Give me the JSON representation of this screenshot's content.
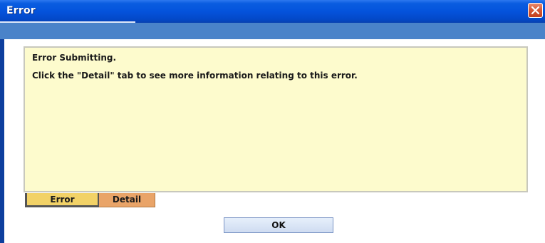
{
  "window": {
    "title": "Error"
  },
  "message": {
    "title": "Error Submitting.",
    "body": "Click the \"Detail\" tab to see more information relating to this error."
  },
  "tabs": [
    {
      "label": "Error",
      "active": true
    },
    {
      "label": "Detail",
      "active": false
    }
  ],
  "buttons": {
    "ok_label": "OK"
  },
  "icons": {
    "close": "close-icon"
  },
  "colors": {
    "titlebar": "#0453dc",
    "band": "#4a83c9",
    "panel_background": "#fdfbcd",
    "error_tab": "#f2d267",
    "detail_tab": "#e9a468",
    "close_button": "#d65a38"
  }
}
